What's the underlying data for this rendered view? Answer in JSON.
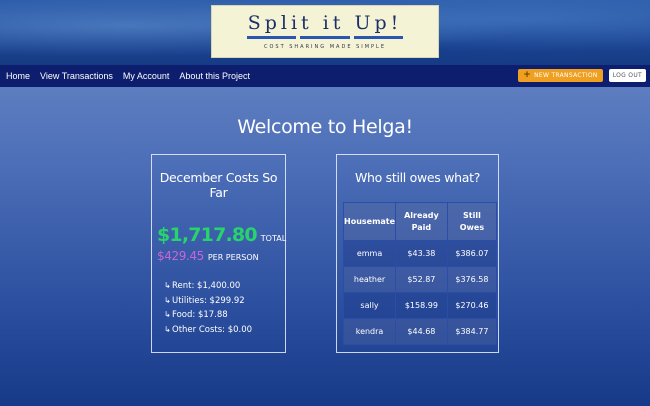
{
  "header": {
    "logo_title": "Split it Up!",
    "logo_tagline": "COST SHARING MADE SIMPLE"
  },
  "nav": {
    "links": [
      "Home",
      "View Transactions",
      "My Account",
      "About this Project"
    ],
    "new_transaction": "NEW TRANSACTION",
    "logout": "LOG OUT"
  },
  "welcome": "Welcome to Helga!",
  "costs": {
    "title": "December Costs So Far",
    "total": "$1,717.80",
    "total_label": "TOTAL",
    "per_person": "$429.45",
    "per_person_label": "PER PERSON",
    "breakdown": [
      "Rent: $1,400.00",
      "Utilities: $299.92",
      "Food: $17.88",
      "Other Costs: $0.00"
    ]
  },
  "owes": {
    "title": "Who still owes what?",
    "headers": [
      "Housemate",
      "Already Paid",
      "Still Owes"
    ],
    "rows": [
      [
        "emma",
        "$43.38",
        "$386.07"
      ],
      [
        "heather",
        "$52.87",
        "$376.58"
      ],
      [
        "sally",
        "$158.99",
        "$270.46"
      ],
      [
        "kendra",
        "$44.68",
        "$384.77"
      ]
    ]
  },
  "colors": {
    "total_green": "#27d36b",
    "per_person_purple": "#c865d6",
    "navbar": "#0e1e6e",
    "new_button": "#f0a020"
  },
  "icons": {
    "new_transaction": "plus-icon",
    "breakdown_item": "return-arrow-icon"
  }
}
